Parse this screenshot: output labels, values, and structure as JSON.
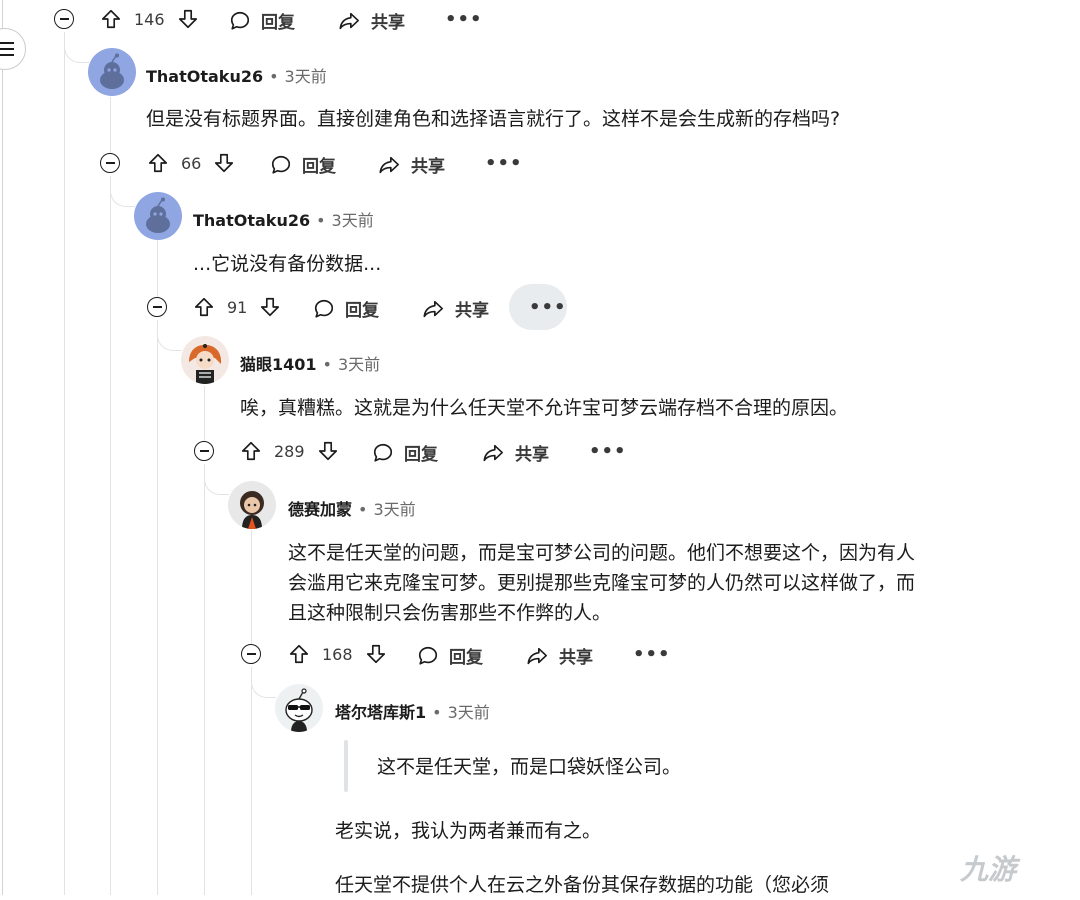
{
  "comments": [
    {
      "author": "ThatOtaku26",
      "time": "3天前",
      "text": "但是没有标题界面。直接创建角色和选择语言就行了。这样不是会生成新的存档吗?",
      "score": "66"
    },
    {
      "author": "ThatOtaku26",
      "time": "3天前",
      "text": "...它说没有备份数据...",
      "score": "91"
    },
    {
      "author": "猫眼1401",
      "time": "3天前",
      "text": "唉，真糟糕。这就是为什么任天堂不允许宝可梦云端存档不合理的原因。",
      "score": "289"
    },
    {
      "author": "德赛加蒙",
      "time": "3天前",
      "text_lines": [
        "这不是任天堂的问题，而是宝可梦公司的问题。他们不想要这个，因为有人",
        "会滥用它来克隆宝可梦。更别提那些克隆宝可梦的人仍然可以这样做了，而",
        "且这种限制只会伤害那些不作弊的人。"
      ],
      "score": "168"
    },
    {
      "author": "塔尔塔库斯1",
      "time": "3天前",
      "quote": "这不是任天堂，而是口袋妖怪公司。",
      "text": "老实说，我认为两者兼而有之。",
      "text2": "任天堂不提供个人在云之外备份其保存数据的功能（您必须"
    }
  ],
  "top_score": "146",
  "labels": {
    "reply": "回复",
    "share": "共享",
    "more": "•••",
    "sep": "•"
  },
  "icons": [
    "upvote-icon",
    "downvote-icon",
    "comment-icon",
    "share-icon",
    "collapse-icon",
    "menu-icon",
    "avatar-icon"
  ],
  "colors": {
    "text": "#1c1c1c",
    "muted": "#6a6a6a",
    "thread_line": "#e1e4e6",
    "avatar_bg": "#8fa6e3"
  },
  "watermark": "九游"
}
